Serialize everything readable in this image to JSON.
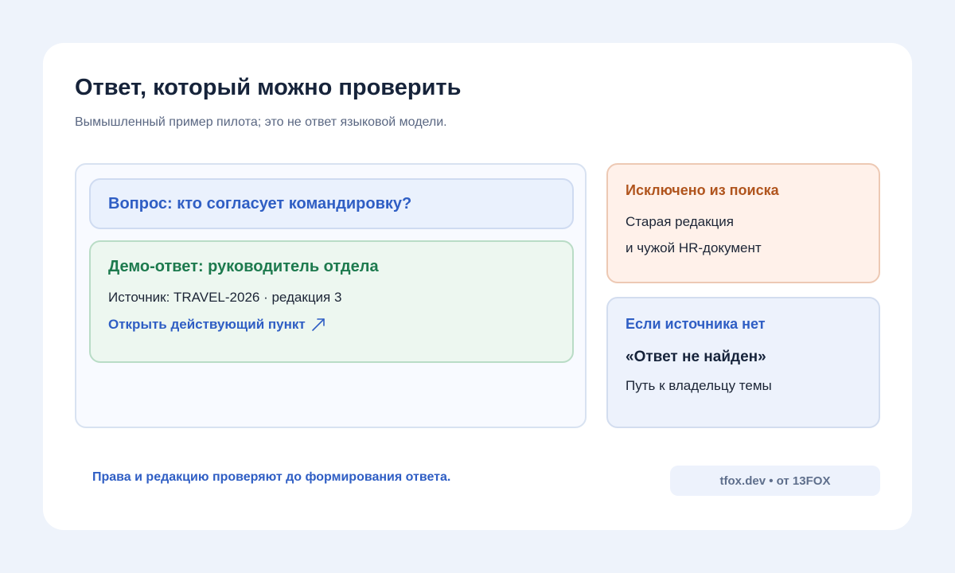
{
  "header": {
    "title": "Ответ, который можно проверить",
    "subtitle": "Вымышленный пример пилота; это не ответ языковой модели."
  },
  "main": {
    "question": "Вопрос: кто согласует командировку?",
    "answer": {
      "title": "Демо-ответ: руководитель отдела",
      "source": "Источник: TRAVEL-2026 · редакция 3",
      "link_label": "Открыть действующий пункт",
      "link_icon": "arrow-up-right-icon"
    }
  },
  "excluded": {
    "title": "Исключено из поиска",
    "lines": [
      "Старая редакция",
      "и чужой HR-документ"
    ]
  },
  "no_source": {
    "title": "Если источника нет",
    "quote": "«Ответ не найден»",
    "line": "Путь к владельцу темы"
  },
  "footer": {
    "note": "Права и редакцию проверяют до формирования ответа.",
    "brand": "tfox.dev • от 13FOX"
  },
  "colors": {
    "accent_blue": "#2f5ec4",
    "accent_green": "#1d7a4e",
    "accent_orange": "#b0541d",
    "title_dark": "#16233a"
  }
}
